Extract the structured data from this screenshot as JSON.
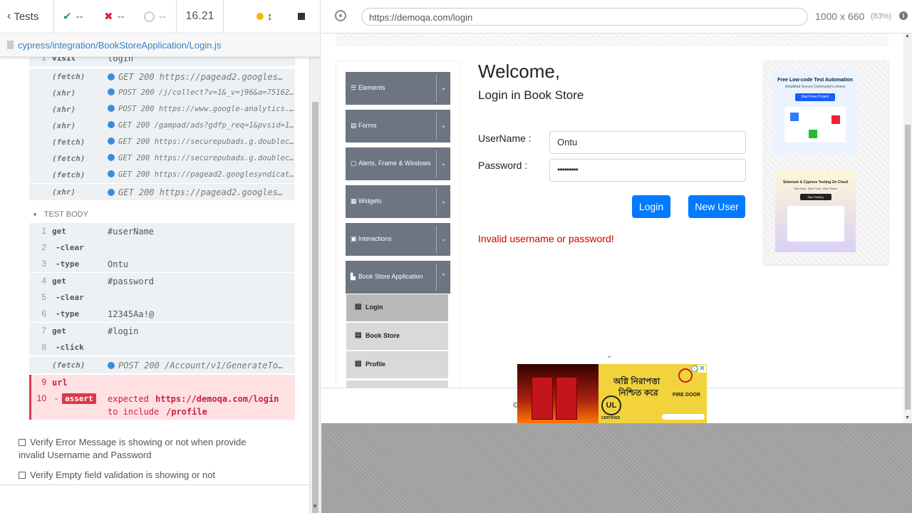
{
  "reporter": {
    "back_label": "Tests",
    "passed": "--",
    "failed": "--",
    "pending": "--",
    "duration": "16.21",
    "spec_path": "cypress/integration/BookStoreApplication/Login.js",
    "first_cmd": {
      "num": "1",
      "name": "visit",
      "msg": "login"
    },
    "network": [
      {
        "name": "(fetch)",
        "msg": "GET 200 https://pagead2.googles…"
      },
      {
        "name": "(xhr)",
        "msg": "POST 200 /j/collect?v=1&_v=j96&a=75162…"
      },
      {
        "name": "(xhr)",
        "msg": "POST 200 https://www.google-analytics.…"
      },
      {
        "name": "(xhr)",
        "msg": "GET 200 /gampad/ads?gdfp_req=1&pvsid=1…"
      },
      {
        "name": "(fetch)",
        "msg": "GET 200 https://securepubads.g.doublec…"
      },
      {
        "name": "(fetch)",
        "msg": "GET 200 https://securepubads.g.doublec…"
      },
      {
        "name": "(fetch)",
        "msg": "GET 200 https://pagead2.googlesyndicat…"
      },
      {
        "name": "(xhr)",
        "msg": "GET 200 https://pagead2.googles…"
      }
    ],
    "test_body_label": "TEST BODY",
    "commands": [
      {
        "num": "1",
        "name": "get",
        "msg": "#userName"
      },
      {
        "num": "2",
        "name": "-clear",
        "msg": ""
      },
      {
        "num": "3",
        "name": "-type",
        "msg": "Ontu"
      },
      {
        "num": "4",
        "name": "get",
        "msg": "#password"
      },
      {
        "num": "5",
        "name": "-clear",
        "msg": ""
      },
      {
        "num": "6",
        "name": "-type",
        "msg": "12345Aa!@"
      },
      {
        "num": "7",
        "name": "get",
        "msg": "#login"
      },
      {
        "num": "8",
        "name": "-click",
        "msg": ""
      }
    ],
    "last_fetch": {
      "name": "(fetch)",
      "msg": "POST 200 /Account/v1/GenerateTo…"
    },
    "url_cmd": {
      "num": "9",
      "name": "url"
    },
    "assert_cmd": {
      "num": "10",
      "badge": "assert",
      "expected_label": "expected",
      "expected_value": "https://demoqa.com/login",
      "include_label": "to include",
      "include_value": "/profile"
    },
    "other_tests": [
      "Verify Error Message is showing or not when provide invalid Username and Password",
      "Verify Empty field validation is showing or not"
    ]
  },
  "browser": {
    "url": "https://demoqa.com/login",
    "viewport": "1000 x 660",
    "scale": "(83%)"
  },
  "app": {
    "menu": [
      {
        "label": "Elements",
        "icon": "list-icon"
      },
      {
        "label": "Forms",
        "icon": "form-icon"
      },
      {
        "label": "Alerts, Frame & Windows",
        "icon": "window-icon"
      },
      {
        "label": "Widgets",
        "icon": "grid-icon"
      },
      {
        "label": "Interactions",
        "icon": "interaction-icon"
      },
      {
        "label": "Book Store Application",
        "icon": "book-icon"
      }
    ],
    "submenu": [
      "Login",
      "Book Store",
      "Profile"
    ],
    "title": "Welcome,",
    "subtitle": "Login in Book Store",
    "username_label": "UserName :",
    "username_value": "Ontu",
    "password_label": "Password :",
    "password_value": "•••••••••",
    "login_button": "Login",
    "new_user_button": "New User",
    "error_message": "Invalid username or password!",
    "ad1_title": "Free Low-code Test Automation",
    "ad1_sub": "Simplified Secure Community's choice",
    "ad1_btn": "Start Free Project",
    "ad2_title": "Selenium & Cypress Testing On Cloud",
    "ad2_sub": "Test More, Save Time, Ship Faster",
    "ad2_btn": "Start Testing",
    "ad3_bengali_1": "অগ্নি নিরাপত্তা",
    "ad3_bengali_2": "নিশ্চিত করে",
    "ad3_brand": "FIRE DOOR",
    "ad3_cert": "CERTIFIED"
  },
  "colors": {
    "accent": "#007bff",
    "error": "#c6233c",
    "menu": "#6c7581"
  }
}
